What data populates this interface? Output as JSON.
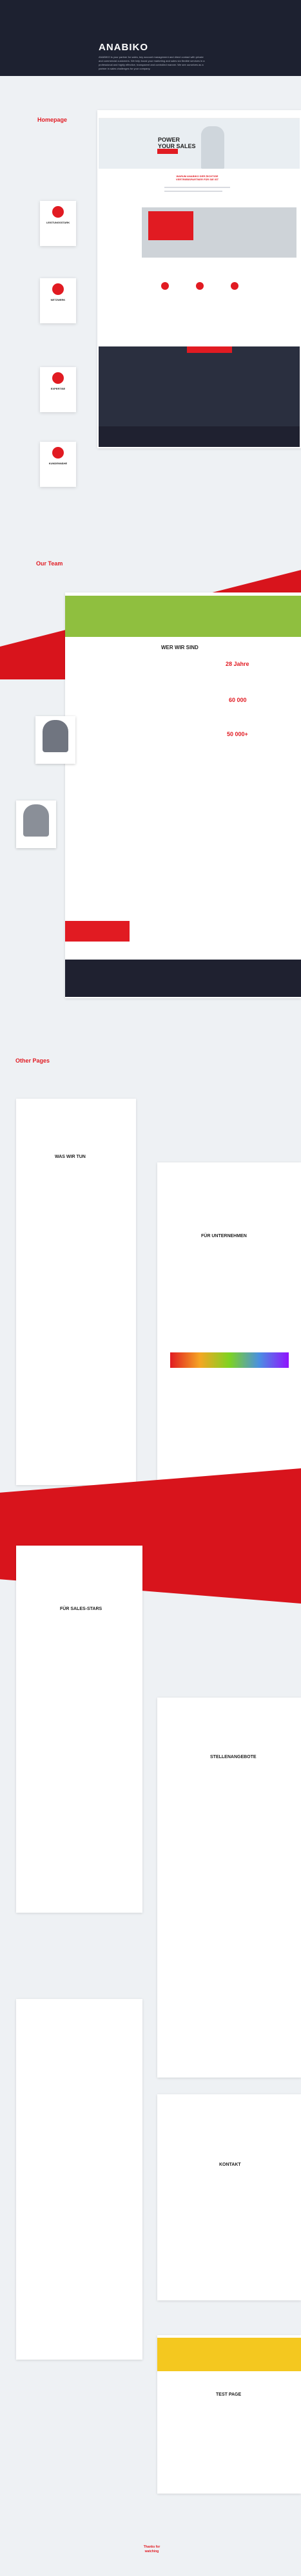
{
  "brand": "ANABIKO",
  "intro": "ANABIKO is your partner for sales, key account management and direct contact with private and commercial customers. We help boost your marketing and sales via flexible services in a professional and highly effective, transparent and controlled manner. We see ourselves as a partner in sales challenges for your company.",
  "sections": {
    "homepage": "Homepage",
    "team": "Our Team",
    "other": "Other Pages",
    "thanks": "Thanks for watching"
  },
  "hero": {
    "headline": "POWER YOUR SALES",
    "sub": "WARUM ANABIKO DER RICHTIGE VERTRIEBSPARTNER FÜR SIE IST"
  },
  "team": {
    "title": "WER WIR SIND",
    "years": "28 Jahre",
    "stat1": "60 000",
    "stat2": "50 000+"
  },
  "pages": {
    "wer": "WAS WIR TUN",
    "unter": "FÜR UNTERNEHMEN",
    "sales": "FÜR SALES-STARS",
    "stellen": "STELLENANGEBOTE",
    "kontakt": "KONTAKT",
    "test": "TEST PAGE"
  },
  "accent": "#e11b22",
  "dark": "#1d2130"
}
